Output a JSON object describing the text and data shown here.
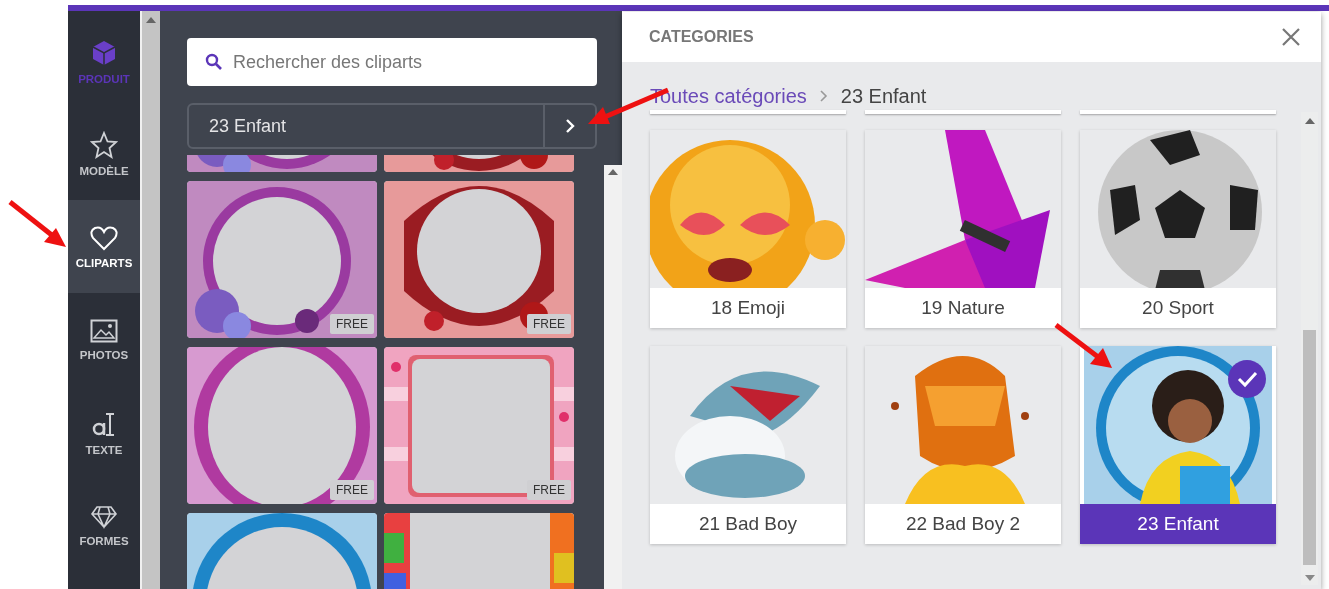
{
  "sidebar": {
    "items": [
      {
        "kind": "product",
        "label": "PRODUIT",
        "selected": false
      },
      {
        "kind": "template",
        "label": "MODÈLE",
        "selected": false
      },
      {
        "kind": "clipart",
        "label": "CLIPARTS",
        "selected": true
      },
      {
        "label": "PHOTOS",
        "selected": false
      },
      {
        "kind": "text",
        "label": "TEXTE",
        "selected": false
      },
      {
        "kind": "shape",
        "label": "FORMES",
        "selected": false
      }
    ]
  },
  "search": {
    "placeholder": "Rechercher des cliparts"
  },
  "category_select": {
    "value": "23 Enfant"
  },
  "cliparts": [
    {
      "kind": "picture"
    },
    {
      "kind": "picture"
    },
    {
      "kind": "picture",
      "badge": "FREE"
    },
    {
      "kind": "picture",
      "badge": "FREE"
    },
    {
      "kind": "picture",
      "badge": "FREE"
    },
    {
      "kind": "picture",
      "badge": "FREE"
    },
    {
      "kind": "picture"
    },
    {
      "kind": "picture"
    }
  ],
  "categories_dialog": {
    "title": "CATEGORIES",
    "breadcrumb": [
      {
        "kind": "link",
        "label": "Toutes catégories"
      },
      {
        "kind": "current",
        "label": "23 Enfant"
      }
    ],
    "cards": [
      {
        "label": "18 Emoji",
        "selected": false
      },
      {
        "label": "19 Nature",
        "selected": false
      },
      {
        "label": "20 Sport",
        "selected": false
      },
      {
        "label": "21 Bad Boy",
        "selected": false
      },
      {
        "label": "22 Bad Boy 2",
        "selected": false
      },
      {
        "label": "23 Enfant",
        "selected": true
      }
    ]
  }
}
